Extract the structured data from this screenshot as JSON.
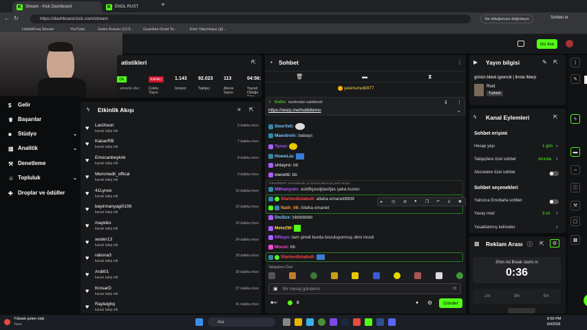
{
  "browser": {
    "tabs": [
      {
        "label": "Stream - Kick Dashboard"
      },
      {
        "label": "ENGL RUST"
      }
    ],
    "url": "https://dashboard.kick.com/stream",
    "verify_text": "Siz olduğunuzu doğrulayın",
    "profile_label": "Sohbet et",
    "bookmarks": [
      "HobbitFreq Stream",
      "YouTube",
      "Gelen Kutusu (13.9...",
      "Guardian Druid Ta...",
      "Emir Yalçınkaya (@..."
    ]
  },
  "topnav": {
    "go_live": "Go live"
  },
  "stats": {
    "title": "atistikleri",
    "status": "KAPALI",
    "partner_hint": "artnerlik eller",
    "items": [
      {
        "label": "Çoklu Yayın",
        "value": ""
      },
      {
        "label": "İzleyici",
        "value": "1.143"
      },
      {
        "label": "Takipçi",
        "value": "92.023"
      },
      {
        "label": "Abone Sayısı",
        "value": "113"
      },
      {
        "label": "Yayınd Olduğu Süre",
        "value": "04:56:"
      }
    ]
  },
  "leftnav": {
    "items": [
      "Gelir",
      "Başarılar",
      "Stüdyo",
      "Analitik",
      "Denetleme",
      "Topluluk",
      "Droplar ve ödüller"
    ]
  },
  "events": {
    "title": "Etkinlik Akışı",
    "sub": "kanalı takip etti",
    "items": [
      {
        "name": "LastXeon",
        "time": "6 dakika önce"
      },
      {
        "name": "KaiserRB",
        "time": "7 dakika önce"
      },
      {
        "name": "Emocanbeyknk",
        "time": "8 dakika önce"
      },
      {
        "name": "Memmedli_offical",
        "time": "9 dakika önce"
      },
      {
        "name": "41Lynxe",
        "time": "15 dakika önce"
      },
      {
        "name": "bayirmanyagi0106",
        "time": "22 dakika önce"
      },
      {
        "name": "maykiks",
        "time": "23 dakika önce"
      },
      {
        "name": "xester13",
        "time": "24 dakika önce"
      },
      {
        "name": "rabona3",
        "time": "28 dakika önce"
      },
      {
        "name": "Ardil01",
        "time": "30 dakika önce"
      },
      {
        "name": "KrosarD",
        "time": "37 dakika önce"
      },
      {
        "name": "Rayleighq",
        "time": "41 dakika önce"
      }
    ]
  },
  "chat": {
    "title": "Sohbet",
    "pinned_user": "yasinumutk977",
    "pinned_by": "BotRix",
    "pinned_suffix": "tarafından sabitlendi",
    "pinned_link": "https://worp.me/hobbitemo",
    "messages": [
      {
        "user": "StonYell:",
        "text": "",
        "color": "#7ec8ff"
      },
      {
        "user": "Maestroix:",
        "text": "babays",
        "color": "#7ec8ff"
      },
      {
        "user": "Tyrox:",
        "text": "",
        "color": "#b05cff"
      },
      {
        "user": "HoweLia:",
        "text": "",
        "color": "#7ec8ff"
      },
      {
        "user": "shiayro:",
        "text": "bb",
        "color": "#ccc"
      },
      {
        "user": "meretti:",
        "text": "bb",
        "color": "#ccc"
      }
    ],
    "reply_hint": "THEx0RDER: al kendende çıt isimli kullanıcıya yanıt veriyor",
    "messages2": [
      {
        "user": "M8hanyum:",
        "text": "asldfkjasdjdasfjas şaka kuzen",
        "color": "#b05cff"
      },
      {
        "user": "StarlordIstabull:",
        "text": "allaha emanettttttttt",
        "color": "#ff4a4a"
      },
      {
        "user": "Nath_06:",
        "text": "Allaha emanet",
        "color": "#ff9a3c"
      },
      {
        "user": "Dw3izx:",
        "text": "bbbbbbbb",
        "color": "#7ec8ff"
      },
      {
        "user": "Mete2W:",
        "text": "",
        "color": "#ffd84a"
      },
      {
        "user": "RRoyn:",
        "text": "tam şimdi burda bozuluyormuş dimi musti",
        "color": "#b05cff"
      },
      {
        "user": "Moosi:",
        "text": "bb",
        "color": "#ff4ad0"
      },
      {
        "user": "StarlordIstabull:",
        "text": "",
        "color": "#ff4a4a"
      }
    ],
    "emote_label": "Takipçilere Özel",
    "input_placeholder": "Bir mesaj gönderin",
    "send": "Gönder",
    "count": "0"
  },
  "streaminfo": {
    "title": "Yayın bilgisi",
    "stream_title": "günün bkluk igrencik | linsta !blerp",
    "game": "Rust",
    "tag": "Turkish"
  },
  "channel_actions": {
    "title": "Kanal Eylemleri",
    "access_title": "Sohbet erişimi",
    "rows": [
      {
        "label": "Hesap yaşı",
        "value": "1 gün"
      },
      {
        "label": "Takipçilere özel sohbet",
        "value": "Anında"
      },
      {
        "label": "Abonelere özel sohbet",
        "value": ""
      }
    ],
    "options_title": "Sohbet seçenekleri",
    "rows2": [
      {
        "label": "Yalnızca Emotlarla sohbet",
        "value": ""
      },
      {
        "label": "Yavaş mod",
        "value": "3 sn."
      },
      {
        "label": "Yasaklanmış kelimeler",
        "value": ""
      }
    ]
  },
  "adbreak": {
    "title": "Reklam Arası",
    "starts_in": "30sn Ad Break starts in",
    "timer": "0:36",
    "options": [
      "1m",
      "3m",
      "5m"
    ]
  },
  "taskbar": {
    "weather": "Yüksek polen riski",
    "weather_sub": "Yarın",
    "search": "Ara",
    "time": "8:50 PM",
    "date": "8/4/2026"
  }
}
